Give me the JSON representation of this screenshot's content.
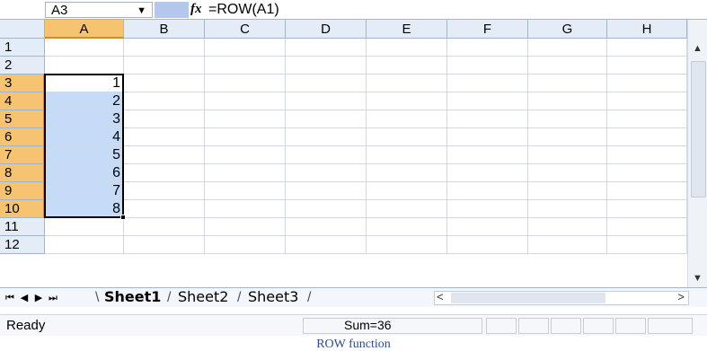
{
  "formula_bar": {
    "name_box_value": "A3",
    "fx_glyph": "fx",
    "formula_text": "=ROW(A1)"
  },
  "grid": {
    "columns": [
      "A",
      "B",
      "C",
      "D",
      "E",
      "F",
      "G",
      "H"
    ],
    "selected_column": "A",
    "rows": [
      "1",
      "2",
      "3",
      "4",
      "5",
      "6",
      "7",
      "8",
      "9",
      "10",
      "11",
      "12"
    ],
    "selected_rows": [
      "3",
      "4",
      "5",
      "6",
      "7",
      "8",
      "9",
      "10"
    ],
    "column_a_values": [
      "",
      "",
      "1",
      "2",
      "3",
      "4",
      "5",
      "6",
      "7",
      "8",
      "",
      ""
    ],
    "active_cell": "A3",
    "selection_range": "A3:A10"
  },
  "sheet_tabs": {
    "nav_first": "⏮",
    "nav_prev": "◀",
    "nav_next": "▶",
    "nav_last": "⏭",
    "tabs": [
      "Sheet1",
      "Sheet2",
      "Sheet3"
    ],
    "active_tab": "Sheet1"
  },
  "status_bar": {
    "ready_text": "Ready",
    "sum_text": "Sum=36"
  },
  "caption": "ROW function",
  "colors": {
    "selected_header": "#f6c470",
    "selected_cells": "#c6dbf7",
    "header_bg": "#e4ecf7"
  }
}
